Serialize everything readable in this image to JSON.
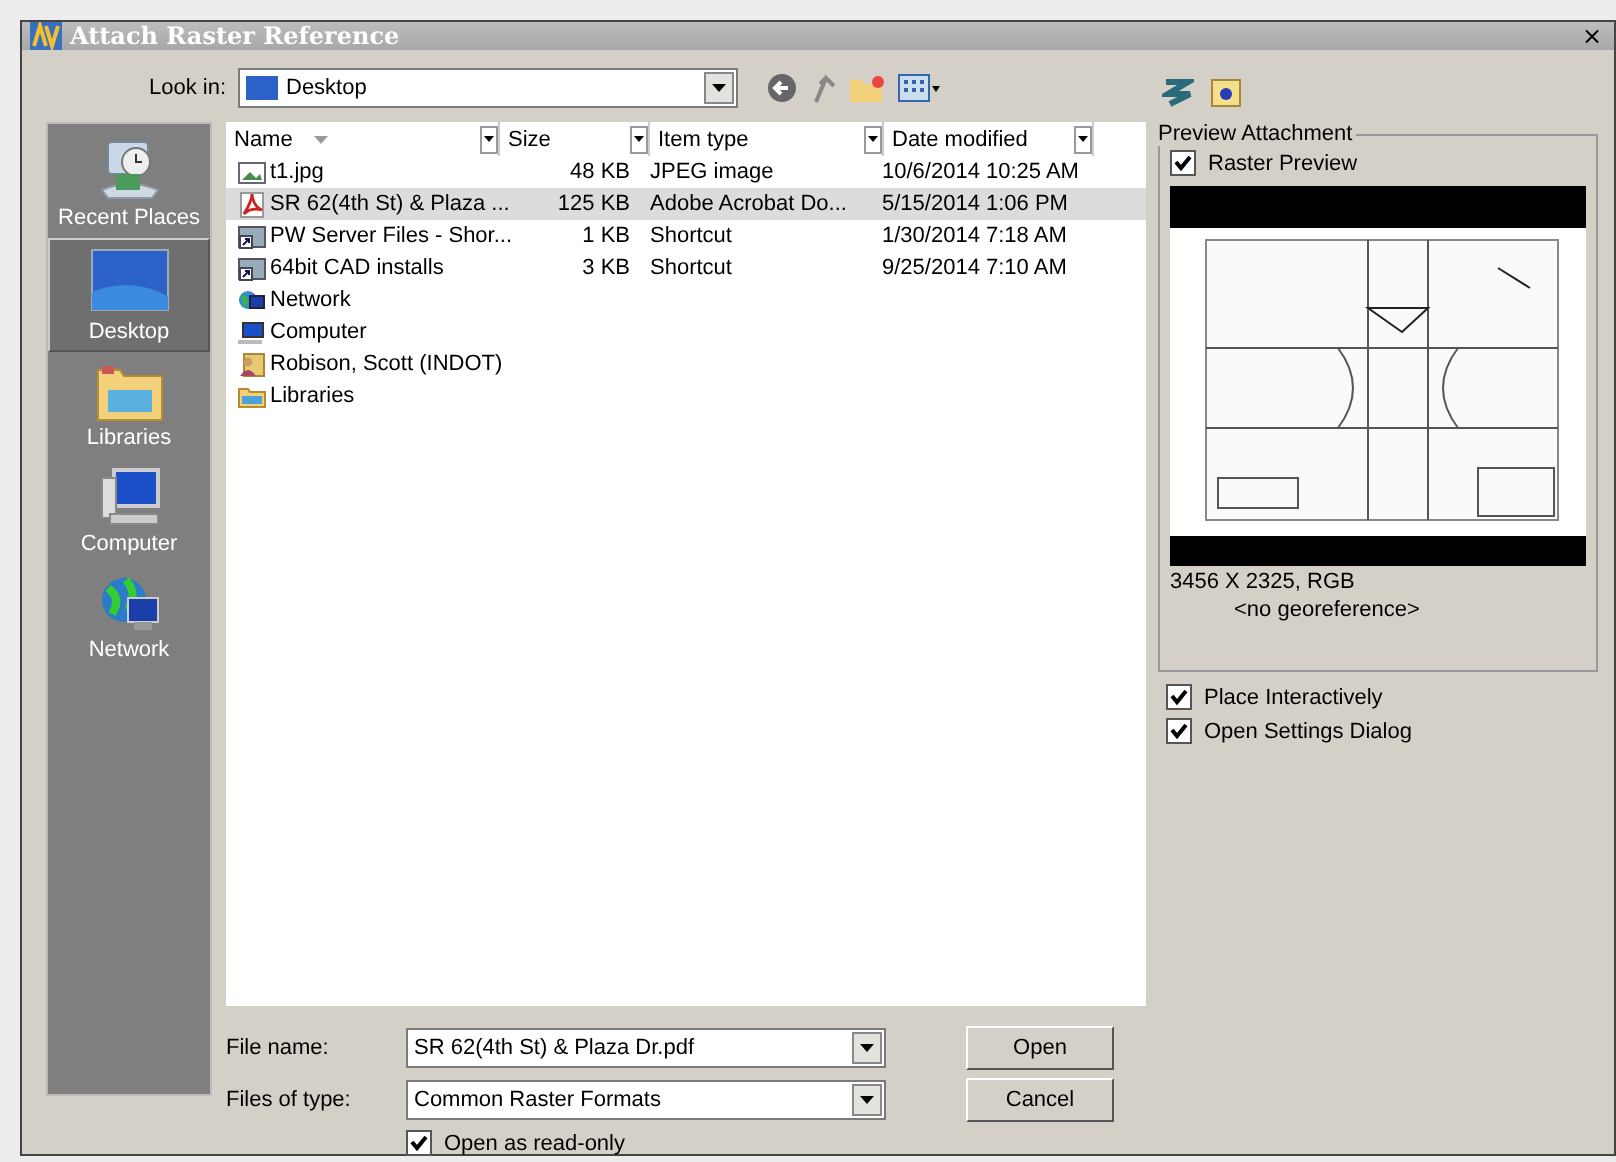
{
  "window": {
    "title": "Attach Raster Reference",
    "close": "×"
  },
  "look_in": {
    "label": "Look in:",
    "value": "Desktop"
  },
  "places": [
    {
      "label": "Recent Places",
      "kind": "recent",
      "selected": false
    },
    {
      "label": "Desktop",
      "kind": "desktop",
      "selected": true
    },
    {
      "label": "Libraries",
      "kind": "libraries",
      "selected": false
    },
    {
      "label": "Computer",
      "kind": "computer",
      "selected": false
    },
    {
      "label": "Network",
      "kind": "network",
      "selected": false
    }
  ],
  "table": {
    "columns": [
      "Name",
      "Size",
      "Item type",
      "Date modified"
    ],
    "rows": [
      {
        "kind": "image",
        "name": "t1.jpg",
        "size": "48 KB",
        "type": "JPEG image",
        "date": "10/6/2014 10:25 AM",
        "selected": false
      },
      {
        "kind": "pdf",
        "name": "SR 62(4th St) & Plaza ...",
        "size": "125 KB",
        "type": "Adobe Acrobat Do...",
        "date": "5/15/2014 1:06 PM",
        "selected": true
      },
      {
        "kind": "shortcut",
        "name": "PW Server Files - Shor...",
        "size": "1 KB",
        "type": "Shortcut",
        "date": "1/30/2014 7:18 AM",
        "selected": false
      },
      {
        "kind": "shortcut",
        "name": "64bit CAD installs",
        "size": "3 KB",
        "type": "Shortcut",
        "date": "9/25/2014 7:10 AM",
        "selected": false
      },
      {
        "kind": "network",
        "name": "Network",
        "selected": false
      },
      {
        "kind": "computer",
        "name": "Computer",
        "selected": false
      },
      {
        "kind": "user",
        "name": "Robison, Scott (INDOT)",
        "selected": false
      },
      {
        "kind": "libraries",
        "name": "Libraries",
        "selected": false
      }
    ]
  },
  "file_name": {
    "label": "File name:",
    "value": "SR 62(4th St) & Plaza Dr.pdf"
  },
  "file_type": {
    "label": "Files of type:",
    "value": "Common Raster Formats"
  },
  "read_only": {
    "label": "Open as read-only",
    "checked": true
  },
  "buttons": [
    "Open",
    "Cancel"
  ],
  "preview": {
    "title": "Preview Attachment",
    "raster_preview": {
      "label": "Raster Preview",
      "checked": true
    },
    "info": "3456 X 2325, RGB",
    "georef": "<no georeference>"
  },
  "options": [
    {
      "label": "Place Interactively",
      "checked": true
    },
    {
      "label": "Open Settings Dialog",
      "checked": true
    }
  ]
}
